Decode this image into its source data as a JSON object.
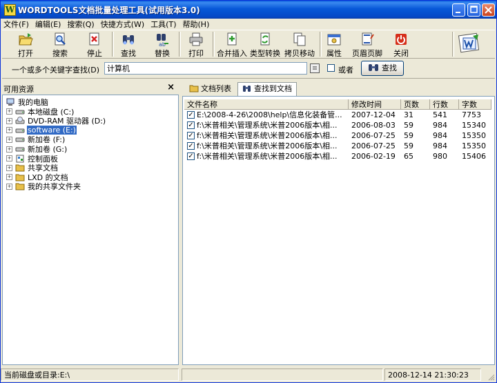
{
  "window": {
    "app_icon_letter": "W",
    "title": "WORDTOOLS文档批量处理工具(试用版本3.0)"
  },
  "menu": [
    "文件(F)",
    "编辑(E)",
    "搜索(Q)",
    "快捷方式(W)",
    "工具(T)",
    "帮助(H)"
  ],
  "toolbar": [
    {
      "label": "打开",
      "icon": "folder-open-icon"
    },
    {
      "label": "搜索",
      "icon": "search-doc-icon"
    },
    {
      "label": "停止",
      "icon": "stop-icon"
    },
    {
      "label": "查找",
      "icon": "binoculars-icon"
    },
    {
      "label": "替换",
      "icon": "replace-icon"
    },
    {
      "label": "打印",
      "icon": "printer-icon"
    },
    {
      "label": "合并插入",
      "icon": "merge-insert-icon"
    },
    {
      "label": "类型转换",
      "icon": "convert-icon"
    },
    {
      "label": "拷贝移动",
      "icon": "copy-move-icon"
    },
    {
      "label": "属性",
      "icon": "properties-icon"
    },
    {
      "label": "页眉页脚",
      "icon": "header-footer-icon"
    },
    {
      "label": "关闭",
      "icon": "power-icon"
    }
  ],
  "search": {
    "label": "一个或多个关键字查找(D)",
    "value": "计算机",
    "or_label": "或者",
    "or_checked": false,
    "button_label": "查找"
  },
  "left_panel": {
    "title": "可用资源",
    "close_glyph": "×",
    "tree": [
      {
        "label": "我的电脑",
        "icon": "computer-icon",
        "level": 0,
        "expander": false,
        "selected": false
      },
      {
        "label": "本地磁盘 (C:)",
        "icon": "hard-drive-icon",
        "level": 1,
        "expander": true,
        "selected": false
      },
      {
        "label": "DVD-RAM 驱动器 (D:)",
        "icon": "dvd-drive-icon",
        "level": 1,
        "expander": true,
        "selected": false
      },
      {
        "label": "software (E:)",
        "icon": "hard-drive-icon",
        "level": 1,
        "expander": true,
        "selected": true
      },
      {
        "label": "新加卷 (F:)",
        "icon": "hard-drive-icon",
        "level": 1,
        "expander": true,
        "selected": false
      },
      {
        "label": "新加卷 (G:)",
        "icon": "hard-drive-icon",
        "level": 1,
        "expander": true,
        "selected": false
      },
      {
        "label": "控制面板",
        "icon": "control-panel-icon",
        "level": 1,
        "expander": true,
        "selected": false
      },
      {
        "label": "共享文档",
        "icon": "folder-icon",
        "level": 1,
        "expander": true,
        "selected": false
      },
      {
        "label": "LXD 的文档",
        "icon": "folder-icon",
        "level": 1,
        "expander": true,
        "selected": false
      },
      {
        "label": "我的共享文件夹",
        "icon": "folder-icon",
        "level": 1,
        "expander": true,
        "selected": false
      }
    ]
  },
  "tabs": [
    {
      "label": "文档列表",
      "icon": "folder-open-icon",
      "active": false
    },
    {
      "label": "查找到文档",
      "icon": "binoculars-icon",
      "active": true
    }
  ],
  "table": {
    "columns": [
      "文件名称",
      "修改时间",
      "页数",
      "行数",
      "字数"
    ],
    "rows": [
      {
        "checked": true,
        "name": "E:\\2008-4-26\\2008\\help\\信息化装备管...",
        "modified": "2007-12-04",
        "pages": "31",
        "lines": "541",
        "words": "7753"
      },
      {
        "checked": true,
        "name": "f:\\米普相关\\管理系统\\米普2006版本\\相...",
        "modified": "2006-08-03",
        "pages": "59",
        "lines": "984",
        "words": "15340"
      },
      {
        "checked": true,
        "name": "f:\\米普相关\\管理系统\\米普2006版本\\相...",
        "modified": "2006-07-25",
        "pages": "59",
        "lines": "984",
        "words": "15350"
      },
      {
        "checked": true,
        "name": "f:\\米普相关\\管理系统\\米普2006版本\\相...",
        "modified": "2006-07-25",
        "pages": "59",
        "lines": "984",
        "words": "15350"
      },
      {
        "checked": true,
        "name": "f:\\米普相关\\管理系统\\米普2006版本\\相...",
        "modified": "2006-02-19",
        "pages": "65",
        "lines": "980",
        "words": "15406"
      }
    ]
  },
  "status": {
    "current_dir": "当前磁盘或目录:E:\\",
    "datetime": "2008-12-14  21:30:23"
  },
  "colors": {
    "title_blue": "#0758d8",
    "selection_blue": "#316ac5",
    "face": "#ece9d8"
  }
}
